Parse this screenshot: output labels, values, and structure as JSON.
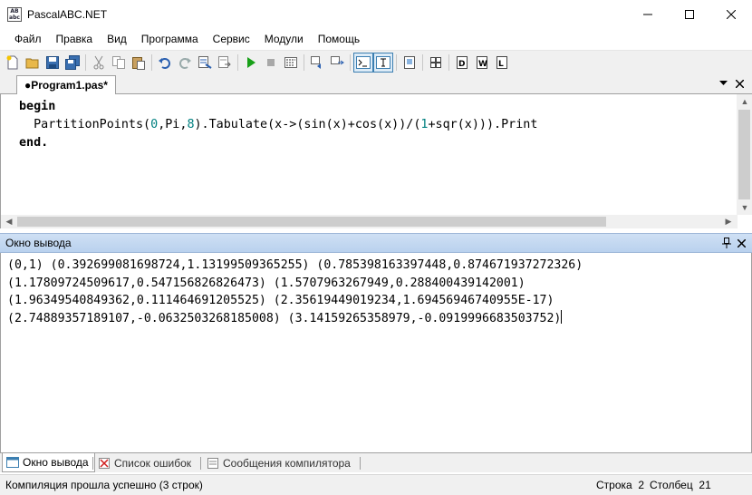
{
  "window": {
    "title": "PascalABC.NET",
    "app_icon_text_top": "AB",
    "app_icon_text_bottom": "abc"
  },
  "menu": [
    "Файл",
    "Правка",
    "Вид",
    "Программа",
    "Сервис",
    "Модули",
    "Помощь"
  ],
  "toolbar_icons": [
    "new-file-icon",
    "open-folder-icon",
    "save-icon",
    "save-all-icon",
    "cut-icon",
    "copy-icon",
    "paste-icon",
    "undo-icon",
    "redo-icon",
    "find-icon",
    "replace-icon",
    "run-icon",
    "stop-icon",
    "compile-icon",
    "step-over-icon",
    "step-into-icon",
    "console-icon",
    "text-mode-icon",
    "form-designer-icon",
    "modules-icon",
    "debug-window-icon",
    "watch-icon",
    "locals-icon"
  ],
  "editor": {
    "tab_label": "●Program1.pas*",
    "code": {
      "line1": "begin",
      "line2_a": "  PartitionPoints(",
      "line2_n0": "0",
      "line2_b": ",Pi,",
      "line2_n8": "8",
      "line2_c": ").Tabulate(x->(sin(x)+cos(x))/(",
      "line2_n1": "1",
      "line2_d": "+sqr(x))).Print",
      "line3": "end."
    }
  },
  "output": {
    "title": "Окно вывода",
    "lines": [
      "(0,1) (0.392699081698724,1.13199509365255) (0.785398163397448,0.874671937272326)",
      "(1.17809724509617,0.547156826826473) (1.5707963267949,0.288400439142001)",
      "(1.96349540849362,0.111464691205525) (2.35619449019234,1.69456946740955E-17)",
      "(2.74889357189107,-0.0632503268185008) (3.14159265358979,-0.0919996683503752)"
    ]
  },
  "bottom_tabs": [
    "Окно вывода",
    "Список ошибок",
    "Сообщения компилятора"
  ],
  "status": {
    "message": "Компиляция прошла успешно (3 строк)",
    "row": "Строка  2",
    "col": "Столбец  21"
  },
  "colors": {
    "output_header": "#c4d8f1",
    "number_literal": "#008080",
    "active_tool": "#dcebf7"
  }
}
